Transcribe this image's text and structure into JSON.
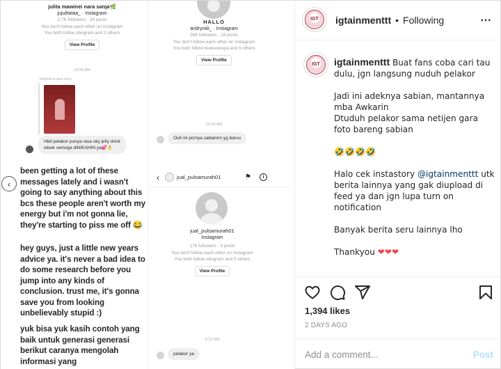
{
  "post_image": {
    "left_column": {
      "profile1": {
        "name": "julita mawinei nara sanja🌿",
        "username": "jujulitataa_ · Instagram",
        "stats": "2.7K followers · 34 posts",
        "line1": "You don't follow each other on Instagram",
        "line2": "You both follow sbngram and 2 others",
        "view_profile": "View Profile"
      },
      "time1": "10:50 AM",
      "replied_label": "Replied to your story",
      "message1": "Hbd pelakor punya rasa oky jelly drink wkwk semoga diNIKAHIN ya💕👌",
      "statement_p1": "been getting a lot of these messages lately and i wasn't going to say anything about this bcs these people aren't worth my energy but i'm not gonna lie, they're starting to piss me off 😂",
      "statement_p2": "hey guys, just a little new years advice ya. it's never a bad idea to do some research before you jump into any kinds of conclusion. trust me, it's gonna save you from looking unbelievably stupid :)",
      "statement_p3": "yuk bisa yuk kasih contoh yang baik untuk generasi generasi berikut caranya mengolah informasi yang"
    },
    "right_column": {
      "profile2": {
        "name": "HALLO",
        "username": "andryniiii_ · Instagram",
        "stats": "266 followers · 18 posts",
        "line1": "You don't follow each other on Instagram",
        "line2": "You both follow teukurassya and 6 others",
        "view_profile": "View Profile"
      },
      "time2": "10:06 AM",
      "message2": "Ouh ini pcrnya sabiannn yg baruu",
      "dm_header_username": "jual_pulsamurah01",
      "profile3": {
        "name": "jual_pulsamurah01",
        "username": "Instagram",
        "stats": "176 followers · 0 posts",
        "line1": "You don't follow each other on Instagram",
        "line2": "You both follow sbngram and 5 others",
        "view_profile": "View Profile"
      },
      "time3": "8:22 AM",
      "message3": "pelakor ya"
    }
  },
  "header": {
    "username": "igtainmenttt",
    "separator": "•",
    "follow_status": "Following",
    "more_icon": "more-horizontal-icon",
    "avatar_text": "IGT"
  },
  "caption": {
    "username": "igtainmenttt",
    "line1": "Buat fans coba cari tau dulu, jgn langsung nuduh pelakor",
    "line2": "Jadi ini adeknya sabian, mantannya mba Awkarin",
    "line3": "Dtuduh pelakor sama netijen gara foto bareng sabian",
    "emoji_line": "🤣🤣🤣🤣",
    "line4_prefix": "Halo cek instastory ",
    "mention": "@igtainmenttt",
    "line4_suffix": " utk berita lainnya yang gak diupload di feed ya dan jgn lupa turn on notification",
    "line5": "Banyak berita seru lainnya lho",
    "line6": "Thankyou",
    "hearts": "❤❤❤"
  },
  "actions": {
    "like_icon": "heart-icon",
    "comment_icon": "comment-icon",
    "share_icon": "share-icon",
    "save_icon": "bookmark-icon"
  },
  "likes": "1,394 likes",
  "date": "2 DAYS AGO",
  "comment": {
    "placeholder": "Add a comment...",
    "post_label": "Post"
  },
  "colors": {
    "mention": "#00376b",
    "post_button_disabled": "#b2dffc",
    "muted": "#8e8e8e",
    "heart_red": "#ed4956"
  }
}
